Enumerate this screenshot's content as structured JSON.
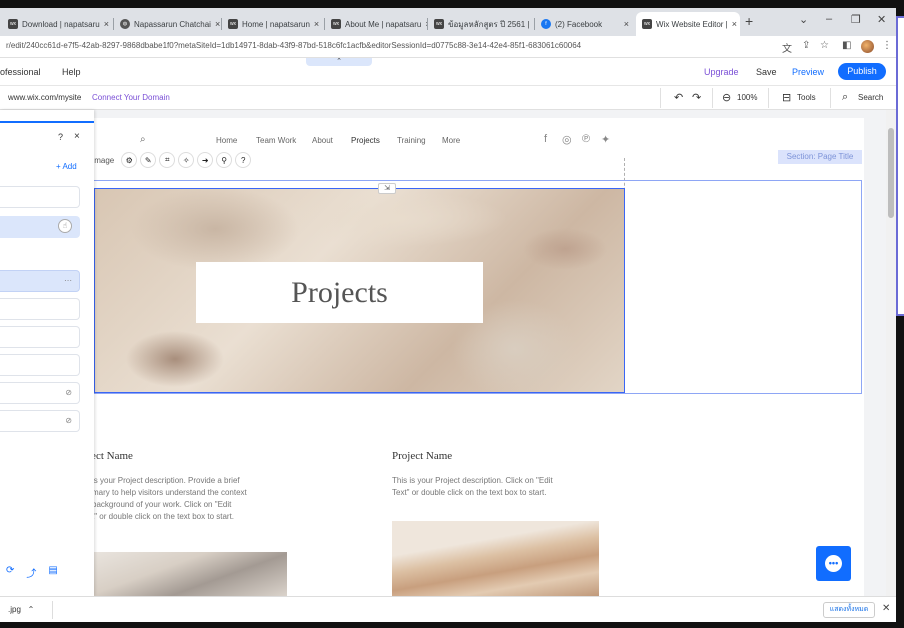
{
  "browser": {
    "tabs": [
      {
        "label": "Download | napatsaru",
        "icon": "wix-icon"
      },
      {
        "label": "Napassarun Chatchai",
        "icon": "globe-icon"
      },
      {
        "label": "Home | napatsarun",
        "icon": "wix-icon"
      },
      {
        "label": "About Me | napatsaru",
        "icon": "wix-icon"
      },
      {
        "label": "ข้อมูลหลักสูตร ปี 2561 |",
        "icon": "wix-icon"
      },
      {
        "label": "(2) Facebook",
        "icon": "facebook-icon"
      },
      {
        "label": "Wix Website Editor | ",
        "icon": "wix-icon",
        "active": true
      }
    ],
    "url": "r/edit/240cc61d-e7f5-42ab-8297-9868dbabe1f0?metaSiteId=1db14971-8dab-43f9-87bd-518c6fc1acfb&editorSessionId=d0775c88-3e14-42e4-85f1-683061c60064"
  },
  "wix_top": {
    "plan": "ofessional",
    "help": "Help",
    "upgrade": "Upgrade",
    "save": "Save",
    "preview": "Preview",
    "publish": "Publish"
  },
  "wix_toolbar": {
    "site_url": "www.wix.com/mysite",
    "connect_domain": "Connect Your Domain",
    "zoom": "100%",
    "tools": "Tools",
    "search": "Search"
  },
  "left_panel": {
    "help": "?",
    "close": "×",
    "add": "+ Add"
  },
  "element_toolbar": {
    "label": "Image"
  },
  "site": {
    "nav": [
      "Home",
      "Team Work",
      "About",
      "Projects",
      "Training",
      "More"
    ],
    "active_nav": "Projects",
    "section_tag": "Section: Page Title",
    "hero_title": "Projects",
    "projects": [
      {
        "name": "ject Name",
        "desc": [
          "is your Project description. Provide a brief",
          "mary to help visitors understand the context",
          "background of your work. Click on \"Edit",
          "t\" or double click on the text box to start."
        ]
      },
      {
        "name": "Project Name",
        "desc": [
          "This is your Project description. Click on \"Edit",
          "Text\" or double click on the text box to start."
        ]
      }
    ]
  },
  "download_shelf": {
    "file": ".jpg",
    "show_all": "แสดงทั้งหมด"
  },
  "colors": {
    "accent": "#116dff",
    "upgrade": "#7a4fd6",
    "selection": "#3a66f5"
  }
}
